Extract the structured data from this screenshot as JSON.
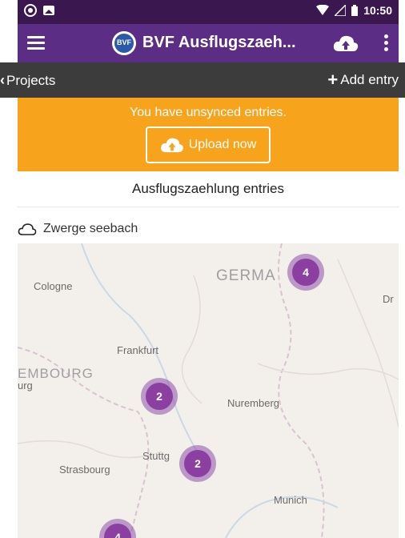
{
  "status_bar": {
    "time": "10:50"
  },
  "app_bar": {
    "title": "BVF Ausflugszaeh...",
    "logo_text": "BVF"
  },
  "sub_nav": {
    "back_label": "Projects",
    "add_label": "Add entry"
  },
  "sync_banner": {
    "message": "You have unsynced entries.",
    "button_label": "Upload now"
  },
  "section_title": "Ausflugszaehlung entries",
  "project": {
    "name": "Zwerge seebach"
  },
  "map": {
    "places": [
      {
        "id": "cologne",
        "label": "Cologne"
      },
      {
        "id": "germany",
        "label": "GERMA"
      },
      {
        "id": "dresden",
        "label": "Dr"
      },
      {
        "id": "frankfurt",
        "label": "Frankfurt"
      },
      {
        "id": "luxembourg",
        "label": "EMBOURG"
      },
      {
        "id": "lux-city",
        "label": "urg"
      },
      {
        "id": "nuremberg",
        "label": "Nuremberg"
      },
      {
        "id": "stuttgart",
        "label": "Stuttg"
      },
      {
        "id": "strasbourg",
        "label": "Strasbourg"
      },
      {
        "id": "munich",
        "label": "Munich"
      }
    ],
    "clusters": [
      {
        "id": "north",
        "count": "4"
      },
      {
        "id": "west",
        "count": "2"
      },
      {
        "id": "stuttgart",
        "count": "2"
      },
      {
        "id": "south",
        "count": "4"
      }
    ]
  },
  "colors": {
    "status_bar": "#3b1750",
    "app_bar": "#5c2d84",
    "sub_nav": "#3c3c3c",
    "banner": "#f7a31c",
    "cluster": "#8b3fa0"
  }
}
